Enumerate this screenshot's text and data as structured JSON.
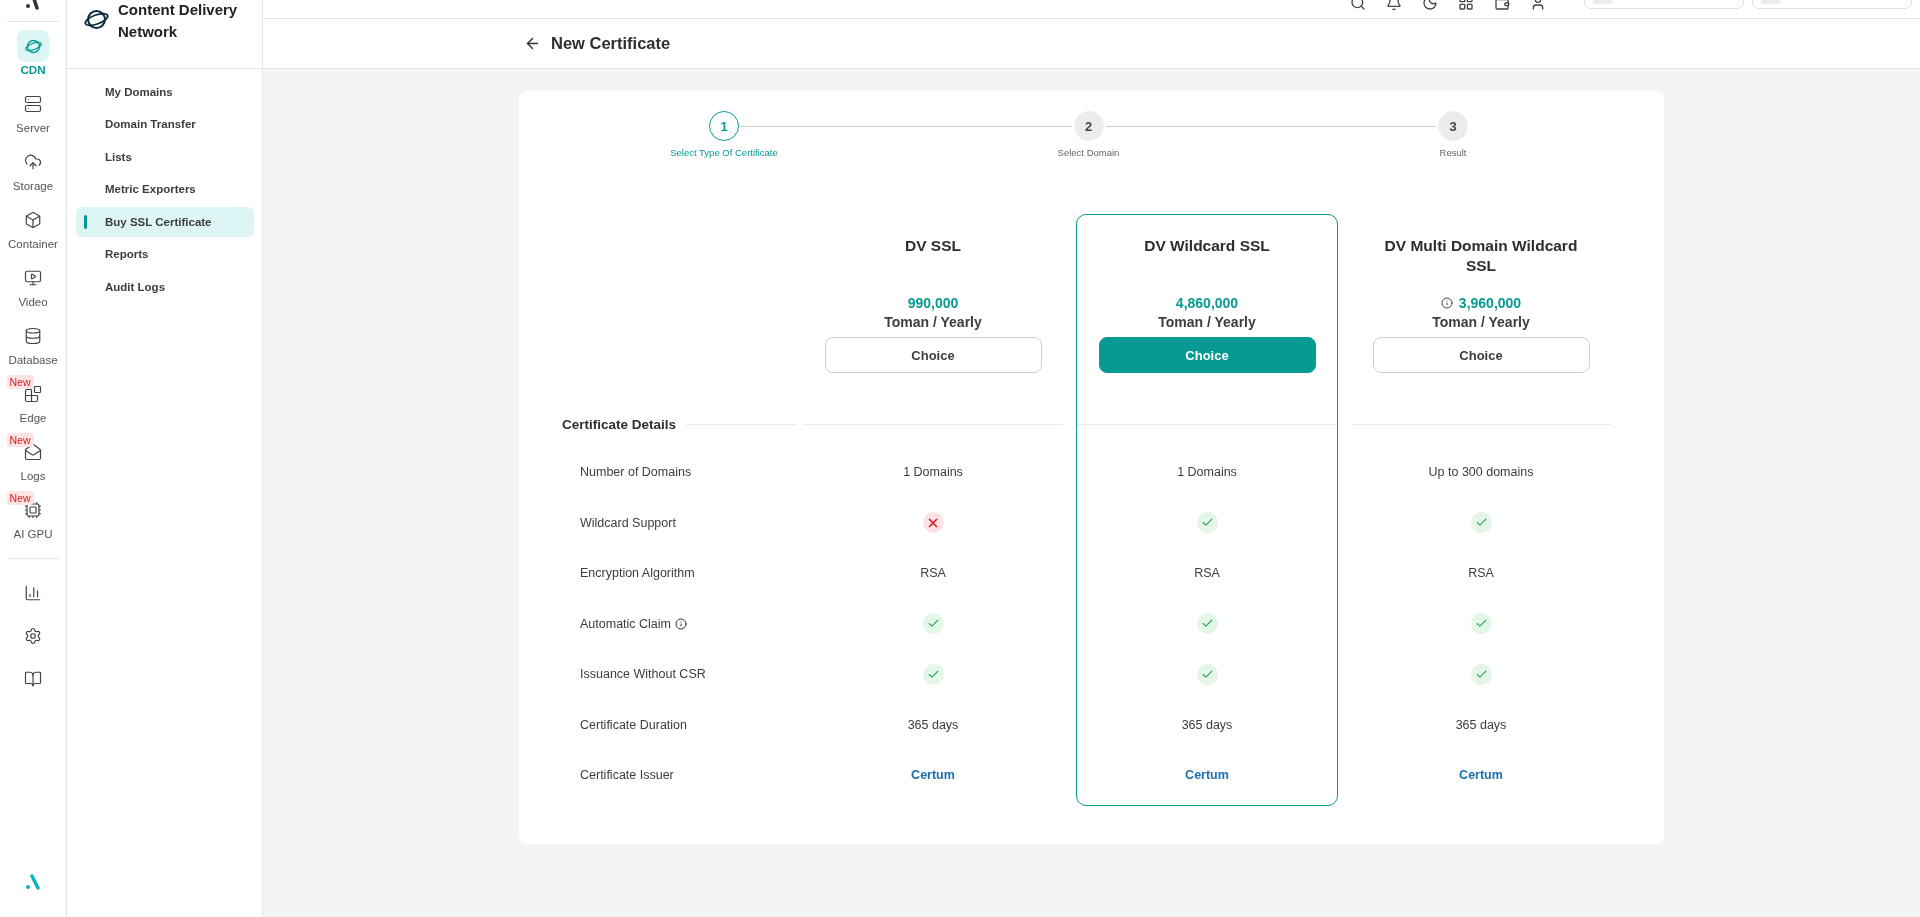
{
  "rail": {
    "items": [
      {
        "label": "CDN",
        "selected": true
      },
      {
        "label": "Server",
        "selected": false
      },
      {
        "label": "Storage",
        "selected": false
      },
      {
        "label": "Container",
        "selected": false
      },
      {
        "label": "Video",
        "selected": false
      },
      {
        "label": "Database",
        "selected": false
      },
      {
        "label": "Edge",
        "selected": false,
        "badge": "New"
      },
      {
        "label": "Logs",
        "selected": false,
        "badge": "New"
      },
      {
        "label": "AI GPU",
        "selected": false,
        "badge": "New"
      }
    ]
  },
  "sidebar": {
    "title": "Content Delivery Network",
    "items": [
      {
        "label": "My Domains",
        "selected": false
      },
      {
        "label": "Domain Transfer",
        "selected": false
      },
      {
        "label": "Lists",
        "selected": false
      },
      {
        "label": "Metric Exporters",
        "selected": false
      },
      {
        "label": "Buy SSL Certificate",
        "selected": true
      },
      {
        "label": "Reports",
        "selected": false
      },
      {
        "label": "Audit Logs",
        "selected": false
      }
    ]
  },
  "page": {
    "title": "New Certificate"
  },
  "stepper": [
    {
      "number": "1",
      "label": "Select Type Of Certificate",
      "selected": true
    },
    {
      "number": "2",
      "label": "Select Domain",
      "selected": false
    },
    {
      "number": "3",
      "label": "Result",
      "selected": false
    }
  ],
  "details_heading": "Certificate Details",
  "detail_labels": [
    {
      "text": "Number of Domains",
      "info": false
    },
    {
      "text": "Wildcard Support",
      "info": false
    },
    {
      "text": "Encryption Algorithm",
      "info": false
    },
    {
      "text": "Automatic Claim",
      "info": true
    },
    {
      "text": "Issuance Without CSR",
      "info": false
    },
    {
      "text": "Certificate Duration",
      "info": false
    },
    {
      "text": "Certificate Issuer",
      "info": false
    }
  ],
  "plans": [
    {
      "name": "DV SSL",
      "price": "990,000",
      "price_info": false,
      "unit": "Toman / Yearly",
      "button": "Choice",
      "selected": false,
      "details": [
        {
          "kind": "text",
          "text": "1 Domains"
        },
        {
          "kind": "check",
          "supported": false
        },
        {
          "kind": "text",
          "text": "RSA"
        },
        {
          "kind": "check",
          "supported": true
        },
        {
          "kind": "check",
          "supported": true
        },
        {
          "kind": "text",
          "text": "365 days"
        },
        {
          "kind": "link",
          "text": "Certum"
        }
      ]
    },
    {
      "name": "DV Wildcard SSL",
      "price": "4,860,000",
      "price_info": false,
      "unit": "Toman / Yearly",
      "button": "Choice",
      "selected": true,
      "details": [
        {
          "kind": "text",
          "text": "1 Domains"
        },
        {
          "kind": "check",
          "supported": true
        },
        {
          "kind": "text",
          "text": "RSA"
        },
        {
          "kind": "check",
          "supported": true
        },
        {
          "kind": "check",
          "supported": true
        },
        {
          "kind": "text",
          "text": "365 days"
        },
        {
          "kind": "link",
          "text": "Certum"
        }
      ]
    },
    {
      "name": "DV Multi Domain Wildcard SSL",
      "price": "3,960,000",
      "price_info": true,
      "unit": "Toman / Yearly",
      "button": "Choice",
      "selected": false,
      "details": [
        {
          "kind": "text",
          "text": "Up to 300 domains"
        },
        {
          "kind": "check",
          "supported": true
        },
        {
          "kind": "text",
          "text": "RSA"
        },
        {
          "kind": "check",
          "supported": true
        },
        {
          "kind": "check",
          "supported": true
        },
        {
          "kind": "text",
          "text": "365 days"
        },
        {
          "kind": "link",
          "text": "Certum"
        }
      ]
    }
  ]
}
